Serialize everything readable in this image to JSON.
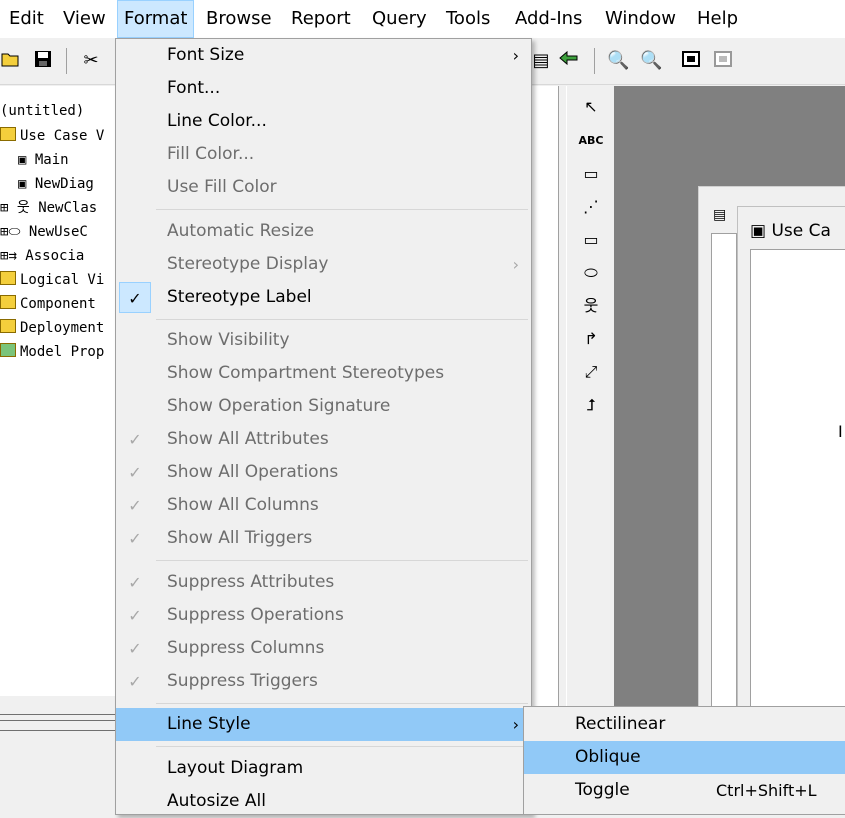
{
  "menubar": {
    "items": [
      "Edit",
      "View",
      "Format",
      "Browse",
      "Report",
      "Query",
      "Tools",
      "Add-Ins",
      "Window",
      "Help"
    ],
    "active": "Format"
  },
  "tree": {
    "items": [
      {
        "label": "(untitled)"
      },
      {
        "label": "Use Case V"
      },
      {
        "label": "Main"
      },
      {
        "label": "NewDiag"
      },
      {
        "label": "NewClas"
      },
      {
        "label": "NewUseC"
      },
      {
        "label": "Associa"
      },
      {
        "label": "Logical Vi"
      },
      {
        "label": "Component"
      },
      {
        "label": "Deployment"
      },
      {
        "label": "Model Prop"
      }
    ]
  },
  "format_menu": {
    "items": [
      {
        "label": "Font Size",
        "enabled": true,
        "submenu": true
      },
      {
        "label": "Font...",
        "enabled": true
      },
      {
        "label": "Line Color...",
        "enabled": true
      },
      {
        "label": "Fill Color...",
        "enabled": false
      },
      {
        "label": "Use Fill Color",
        "enabled": false
      },
      {
        "label": "Automatic Resize",
        "enabled": false
      },
      {
        "label": "Stereotype Display",
        "enabled": false,
        "submenu": true
      },
      {
        "label": "Stereotype Label",
        "enabled": true,
        "checked": true
      },
      {
        "label": "Show Visibility",
        "enabled": false
      },
      {
        "label": "Show Compartment Stereotypes",
        "enabled": false
      },
      {
        "label": "Show Operation Signature",
        "enabled": false
      },
      {
        "label": "Show All Attributes",
        "enabled": false,
        "checked": true
      },
      {
        "label": "Show All Operations",
        "enabled": false,
        "checked": true
      },
      {
        "label": "Show All Columns",
        "enabled": false,
        "checked": true
      },
      {
        "label": "Show All Triggers",
        "enabled": false,
        "checked": true
      },
      {
        "label": "Suppress Attributes",
        "enabled": false,
        "checked": true
      },
      {
        "label": "Suppress Operations",
        "enabled": false,
        "checked": true
      },
      {
        "label": "Suppress Columns",
        "enabled": false,
        "checked": true
      },
      {
        "label": "Suppress Triggers",
        "enabled": false,
        "checked": true
      },
      {
        "label": "Line Style",
        "enabled": true,
        "submenu": true,
        "highlighted": true
      },
      {
        "label": "Layout Diagram",
        "enabled": true
      },
      {
        "label": "Autosize All",
        "enabled": true
      }
    ]
  },
  "line_style_submenu": {
    "items": [
      {
        "label": "Rectilinear",
        "shortcut": ""
      },
      {
        "label": "Oblique",
        "shortcut": "",
        "highlighted": true
      },
      {
        "label": "Toggle",
        "shortcut": "Ctrl+Shift+L"
      }
    ]
  },
  "diagram_window": {
    "title": "Use Ca",
    "canvas_char": "I"
  },
  "toolbox": {
    "abc_label": "ABC"
  },
  "colors": {
    "menu_highlight": "#91c9f7",
    "check_bg": "#cce8ff",
    "workspace": "#808080"
  }
}
